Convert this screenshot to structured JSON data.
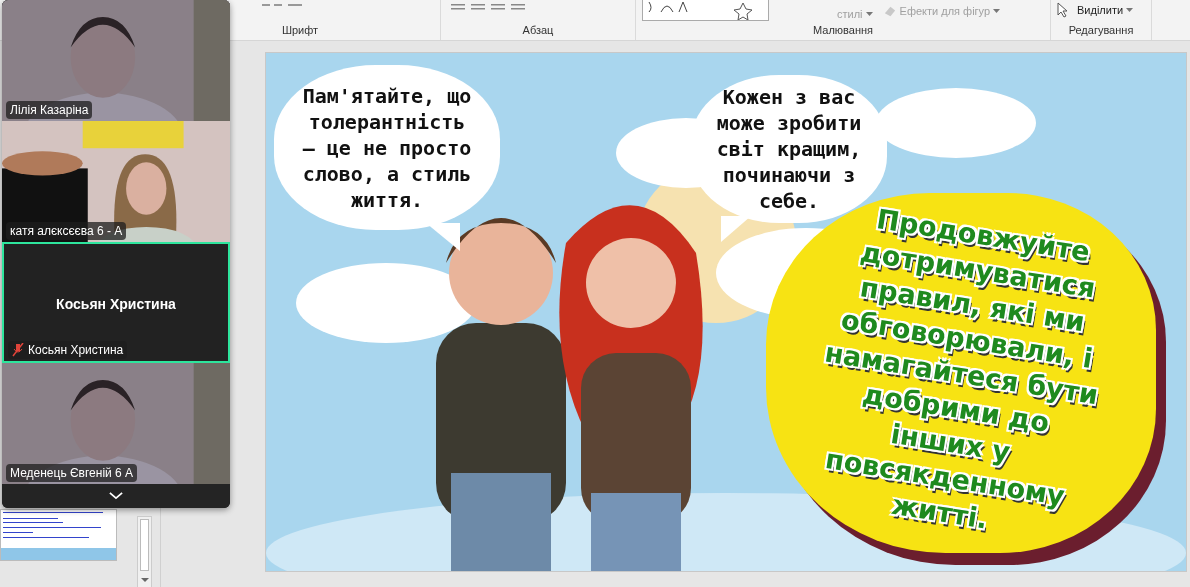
{
  "ribbon": {
    "groups": [
      {
        "label": "Шрифт",
        "kind": "font"
      },
      {
        "label": "Абзац",
        "kind": "paragraph"
      },
      {
        "label": "Малювання",
        "kind": "drawing",
        "commands": [
          "стилі",
          "Ефекти для фігур"
        ]
      },
      {
        "label": "Редагування",
        "kind": "editing",
        "commands": [
          "Виділити"
        ]
      }
    ]
  },
  "video_call": {
    "tiles": [
      {
        "name": "Лілія Казаріна",
        "kind": "video",
        "muted": false,
        "active": false
      },
      {
        "name": "катя алєксєєва 6 - А",
        "kind": "video",
        "muted": false,
        "active": false
      },
      {
        "display_name": "Косьян Христина",
        "name": "Косьян Христина",
        "kind": "avatar",
        "muted": true,
        "active": true
      },
      {
        "name": "Меденець Євгеній 6 А",
        "kind": "video",
        "muted": false,
        "active": false
      }
    ]
  },
  "slide": {
    "bubbles": [
      {
        "text": "Пам'ятайте, що толерантність — це не просто слово, а стиль життя."
      },
      {
        "text": "Кожен з вас може зробити світ кращим, починаючи з себе."
      }
    ],
    "callout": "Продовжуйте дотримуватися правил, які ми обговорювали, і намагайтеся бути добрими до інших у повсякденному житті."
  }
}
